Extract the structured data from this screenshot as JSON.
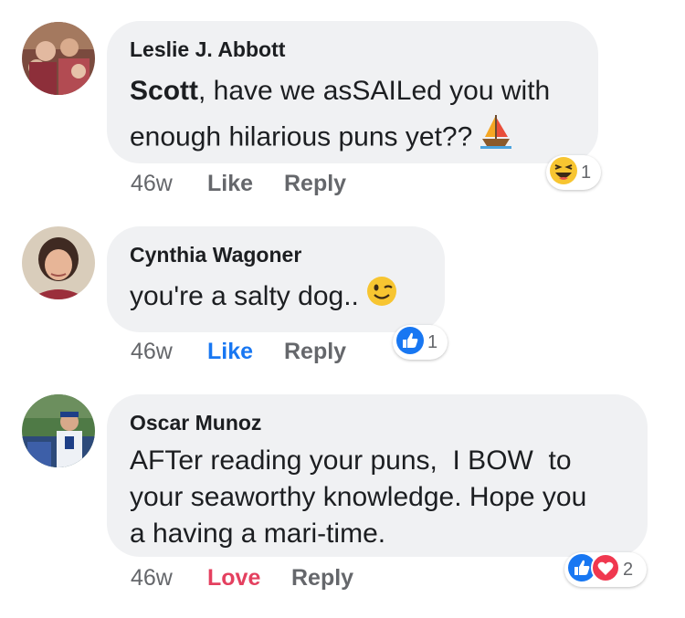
{
  "comments": [
    {
      "author": "Leslie J. Abbott",
      "mention": "Scott",
      "text_line1": ", have we asSAILed you with",
      "text_line2": "enough hilarious puns yet??",
      "time": "46w",
      "like_label": "Like",
      "reply_label": "Reply",
      "reaction_count": "1",
      "reaction_icon": "laughing-emoji",
      "inline_emoji": "sailboat"
    },
    {
      "author": "Cynthia Wagoner",
      "text_line1": "you're a salty dog..",
      "time": "46w",
      "like_label": "Like",
      "reply_label": "Reply",
      "reaction_count": "1",
      "reaction_icon": "thumbs-up",
      "inline_emoji": "winking-face",
      "liked_by_viewer": true
    },
    {
      "author": "Oscar Munoz",
      "text_line1": "AFTer reading your puns,  I BOW  to",
      "text_line2": "your seaworthy knowledge. Hope you",
      "text_line3": "a having a mari-time.",
      "time": "46w",
      "love_label": "Love",
      "reply_label": "Reply",
      "reaction_count": "2",
      "reaction_icons": [
        "thumbs-up",
        "heart"
      ],
      "loved_by_viewer": true
    }
  ],
  "colors": {
    "bubble": "#f0f1f3",
    "like_blue": "#1877f2",
    "love_red": "#e4405f",
    "meta_gray": "#65676b"
  }
}
